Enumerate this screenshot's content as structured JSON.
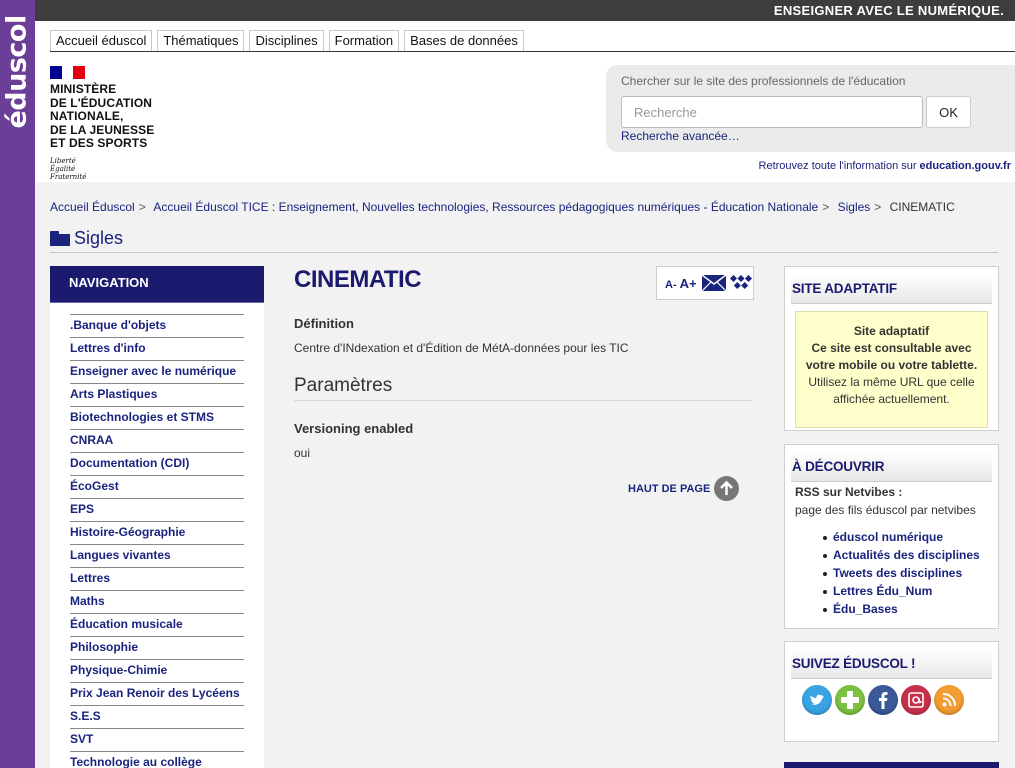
{
  "brand": {
    "name": "éduscol",
    "color": "#6b3e98"
  },
  "top_bar": {
    "slogan": "ENSEIGNER AVEC LE NUMÉRIQUE."
  },
  "tabs": [
    {
      "label": "Accueil éduscol"
    },
    {
      "label": "Thématiques"
    },
    {
      "label": "Disciplines"
    },
    {
      "label": "Formation"
    },
    {
      "label": "Bases de données"
    }
  ],
  "logo": {
    "ministry_lines": [
      "MINISTÈRE",
      "DE L'ÉDUCATION",
      "NATIONALE,",
      "DE LA JEUNESSE",
      "ET DES SPORTS"
    ],
    "motto_lines": [
      "Liberté",
      "Égalité",
      "Fraternité"
    ]
  },
  "search": {
    "label": "Chercher sur le site des professionnels de l'éducation",
    "placeholder": "Recherche",
    "button": "OK",
    "advanced": "Recherche avancée…"
  },
  "retrouvez": {
    "text": "Retrouvez toute l'information sur",
    "link": "education.gouv.fr"
  },
  "breadcrumb": [
    {
      "label": "Accueil Éduscol"
    },
    {
      "label": "Accueil Éduscol TICE : Enseignement, Nouvelles technologies, Ressources pédagogiques numériques - Éducation Nationale"
    },
    {
      "label": "Sigles"
    },
    {
      "label": "CINEMATIC"
    }
  ],
  "section": {
    "title": "Sigles"
  },
  "navigation": {
    "header": "NAVIGATION",
    "items": [
      ".Banque d'objets",
      "Lettres d'info",
      "Enseigner avec le numérique",
      "Arts Plastiques",
      "Biotechnologies et STMS",
      "CNRAA",
      "Documentation (CDI)",
      "ÉcoGest",
      "EPS",
      "Histoire-Géographie",
      "Langues vivantes",
      "Lettres",
      "Maths",
      "Éducation musicale",
      "Philosophie",
      "Physique-Chimie",
      "Prix Jean Renoir des Lycéens",
      "S.E.S",
      "SVT",
      "Technologie au collège"
    ]
  },
  "content": {
    "title": "CINEMATIC",
    "font_tool": {
      "minus": "A-",
      "plus": "A+"
    },
    "definition_label": "Définition",
    "definition_value": "Centre d'INdexation et d'Édition de MétA-données pour les TIC",
    "params_title": "Paramètres",
    "versioning_label": "Versioning enabled",
    "versioning_value": "oui",
    "back_to_top": "HAUT DE PAGE"
  },
  "sidebar": {
    "adaptive": {
      "title": "SITE ADAPTATIF",
      "line1": "Site adaptatif",
      "line2": "Ce site est consultable avec votre mobile ou votre tablette.",
      "line3": "Utilisez la même URL que celle affichée actuellement."
    },
    "discover": {
      "title": "À DÉCOUVRIR",
      "rss_title": "RSS sur Netvibes :",
      "rss_sub": "page des fils éduscol par netvibes",
      "links": [
        "éduscol numérique",
        "Actualités des disciplines",
        "Tweets des disciplines",
        "Lettres Édu_Num",
        "Édu_Bases"
      ]
    },
    "follow": {
      "title": "SUIVEZ ÉDUSCOL !",
      "icons": [
        "twitter-icon",
        "viadeo-icon",
        "facebook-icon",
        "email-icon",
        "rss-icon"
      ]
    }
  },
  "colors": {
    "navy": "#1a1a6e",
    "link": "#1a237e",
    "highlight": "#ffffcc"
  }
}
